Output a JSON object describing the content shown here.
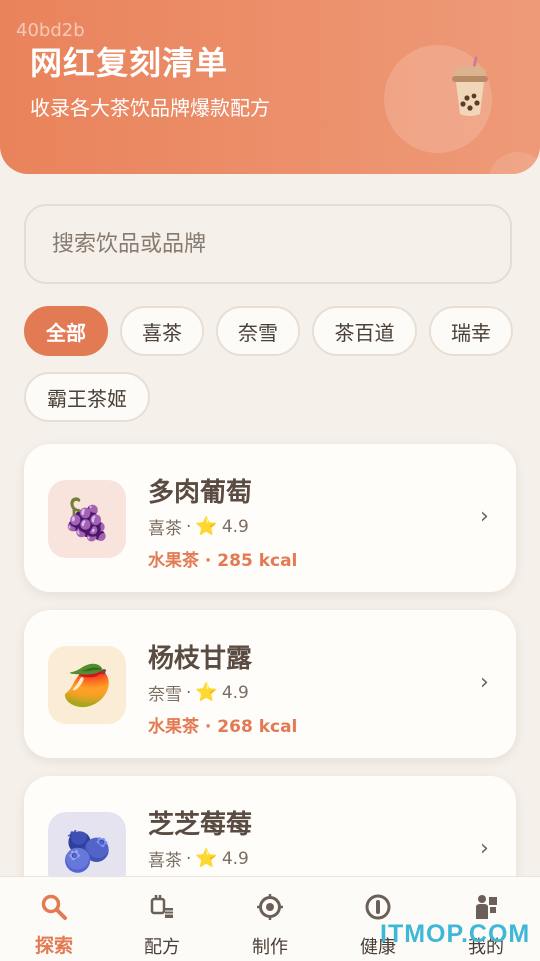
{
  "watermark": "40bd2b",
  "header": {
    "title": "网红复刻清单",
    "subtitle": "收录各大茶饮品牌爆款配方"
  },
  "search": {
    "placeholder": "搜索饮品或品牌"
  },
  "filters": [
    {
      "label": "全部",
      "active": true
    },
    {
      "label": "喜茶",
      "active": false
    },
    {
      "label": "奈雪",
      "active": false
    },
    {
      "label": "茶百道",
      "active": false
    },
    {
      "label": "瑞幸",
      "active": false
    },
    {
      "label": "霸王茶姬",
      "active": false
    }
  ],
  "drinks": [
    {
      "name": "多肉葡萄",
      "brand": "喜茶",
      "sep": "·",
      "star": "⭐",
      "rating": "4.9",
      "tag": "水果茶 · 285 kcal",
      "emoji": "🍇",
      "chevron": "›"
    },
    {
      "name": "杨枝甘露",
      "brand": "奈雪",
      "sep": "·",
      "star": "⭐",
      "rating": "4.9",
      "tag": "水果茶 · 268 kcal",
      "emoji": "🥭",
      "chevron": "›"
    },
    {
      "name": "芝芝莓莓",
      "brand": "喜茶",
      "sep": "·",
      "star": "⭐",
      "rating": "4.9",
      "tag": "",
      "emoji": "🫐",
      "chevron": "›"
    }
  ],
  "tabs": [
    {
      "label": "探索",
      "icon": "search-icon",
      "active": true
    },
    {
      "label": "配方",
      "icon": "recipe-icon",
      "active": false
    },
    {
      "label": "制作",
      "icon": "target-icon",
      "active": false
    },
    {
      "label": "健康",
      "icon": "health-icon",
      "active": false
    },
    {
      "label": "我的",
      "icon": "profile-icon",
      "active": false
    }
  ],
  "site_watermark": "ITMOP.COM",
  "colors": {
    "accent": "#e27a53",
    "header_start": "#e9835b",
    "header_end": "#ee9a78",
    "background": "#f5f0ea"
  }
}
